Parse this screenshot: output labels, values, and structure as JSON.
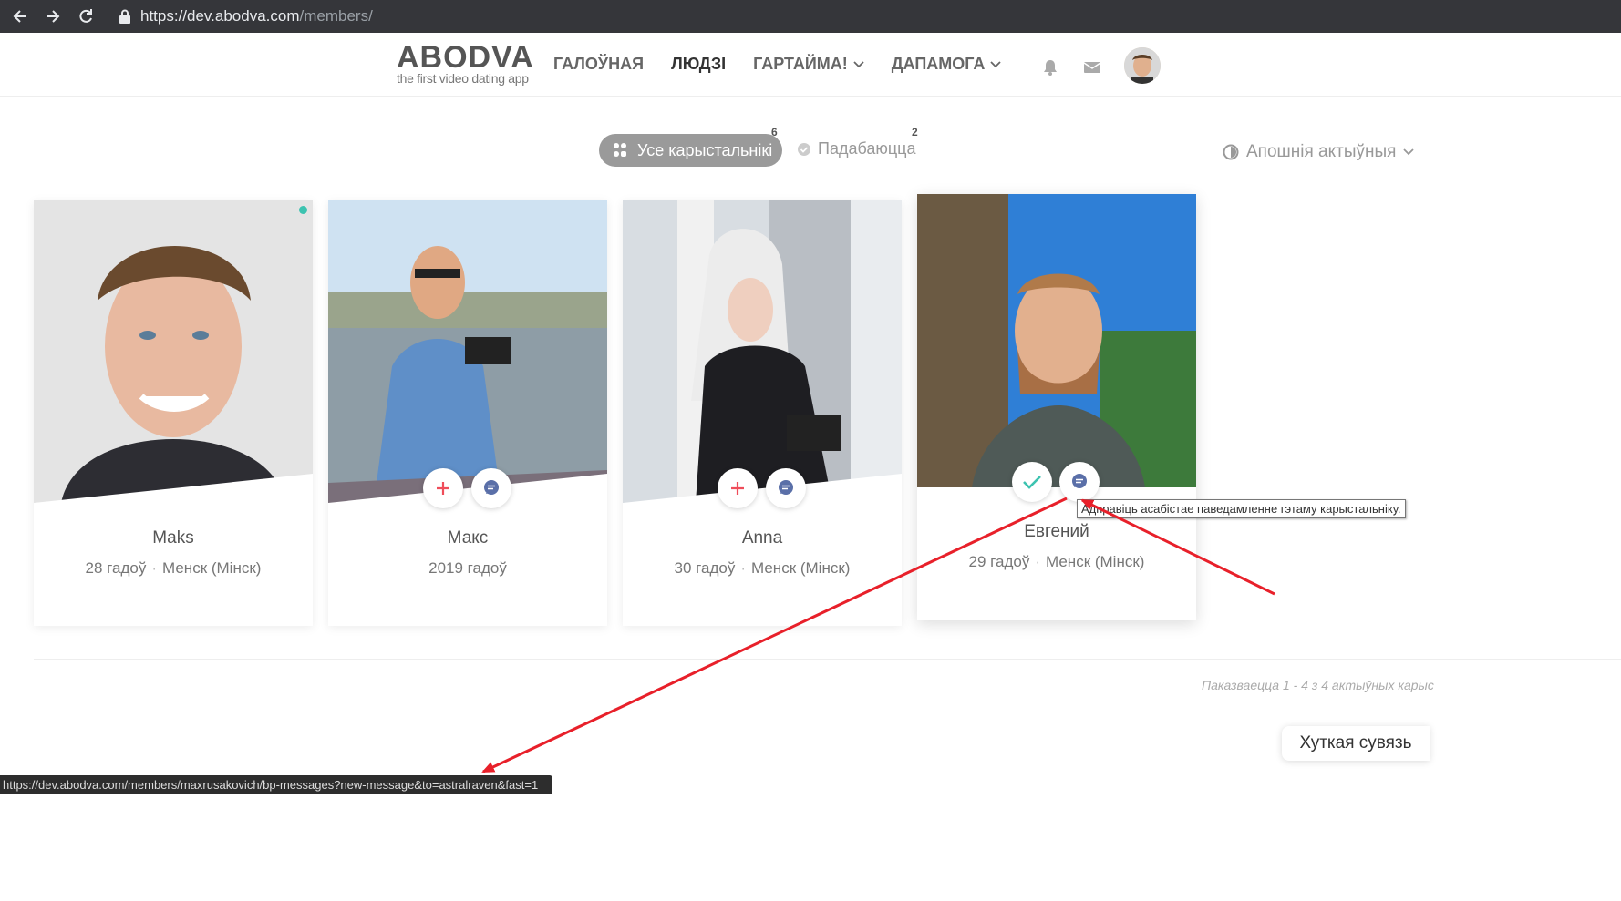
{
  "browser": {
    "url_domain": "https://dev.abodva.com",
    "url_path": "/members/",
    "status_url": "https://dev.abodva.com/members/maxrusakovich/bp-messages?new-message&to=astralraven&fast=1"
  },
  "header": {
    "brand": "ABODVA",
    "tagline": "the first video dating app",
    "nav": [
      "ГАЛОЎНАЯ",
      "ЛЮДЗІ",
      "ГАРТАЙМА!",
      "ДАПАМОГА"
    ]
  },
  "filters": {
    "all_label": "Усе карыстальнікі",
    "all_count": "6",
    "fav_label": "Падабаюцца",
    "fav_count": "2",
    "sort_label": "Апошнія актыўныя"
  },
  "members": [
    {
      "name": "Maks",
      "age": "28 гадоў",
      "city": "Менск (Мінск)"
    },
    {
      "name": "Макс",
      "age": "2019 гадоў",
      "city": ""
    },
    {
      "name": "Anna",
      "age": "30 гадоў",
      "city": "Менск (Мінск)"
    },
    {
      "name": "Евгений",
      "age": "29 гадоў",
      "city": "Менск (Мінск)"
    }
  ],
  "tooltip": "Адправіць асабістае паведамленне гэтаму карыстальніку.",
  "pagination": "Паказваецца 1 - 4 з 4 актыўных карыс",
  "quick_contact": "Хуткая сувязь",
  "colors": {
    "accent": "#3cc3b0",
    "add": "#ef4d5a",
    "message": "#5a6fa8",
    "arrow": "#e8202a"
  }
}
